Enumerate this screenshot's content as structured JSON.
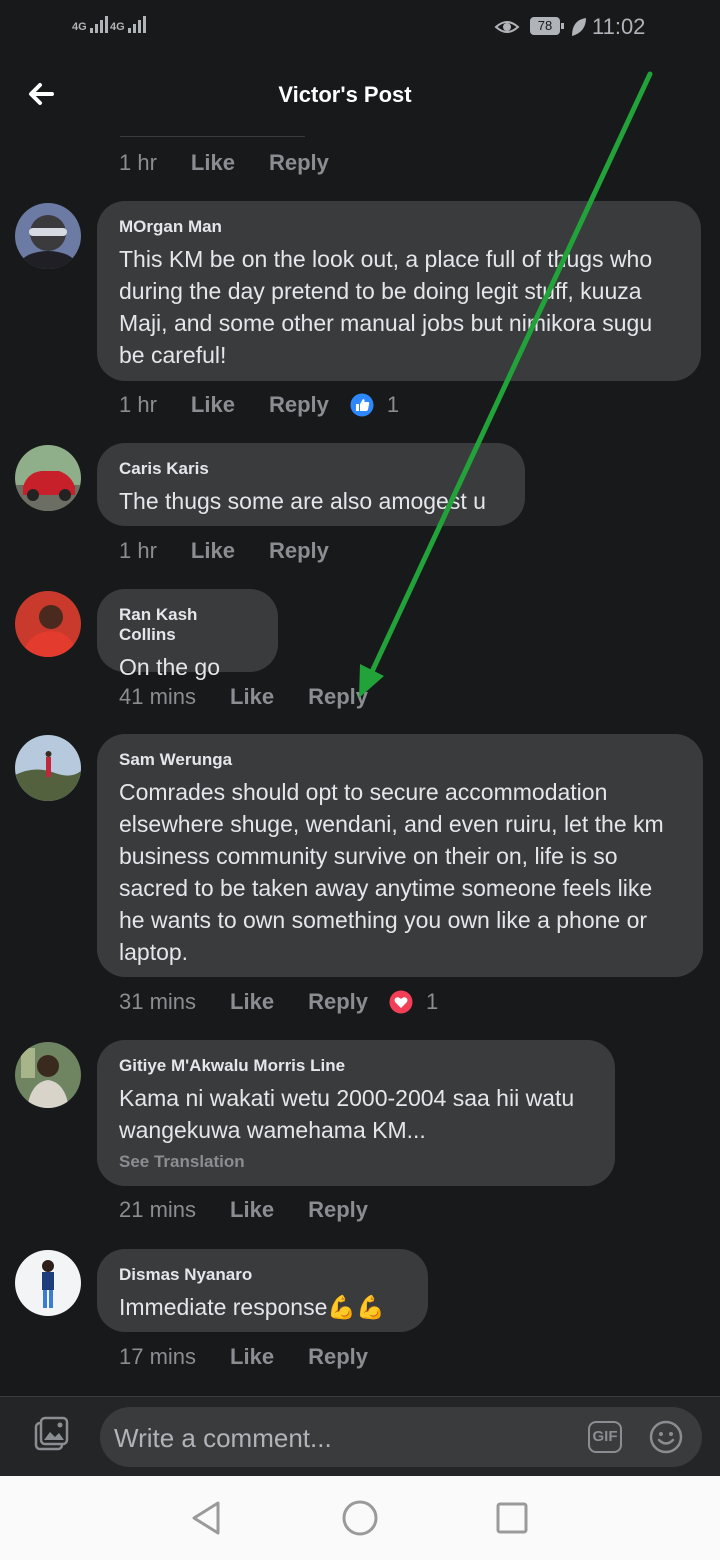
{
  "status_bar": {
    "signal_1": "4G",
    "signal_2": "4G",
    "battery": "78",
    "time": "11:02"
  },
  "header": {
    "title": "Victor's Post"
  },
  "prev_comment_meta": {
    "time": "1 hr",
    "like": "Like",
    "reply": "Reply"
  },
  "comments": [
    {
      "author": "MOrgan Man",
      "text": "This KM be on the look out, a place full of thugs who during the day pretend to be doing legit stuff, kuuza Maji, and some other manual jobs but nimikora sugu be careful!",
      "time": "1 hr",
      "like": "Like",
      "reply": "Reply",
      "reaction": "like-icon",
      "reaction_count": "1"
    },
    {
      "author": "Caris Karis",
      "text": "The thugs some are also amogest u",
      "time": "1 hr",
      "like": "Like",
      "reply": "Reply"
    },
    {
      "author": "Ran Kash Collins",
      "text": "On the go",
      "time": "41 mins",
      "like": "Like",
      "reply": "Reply"
    },
    {
      "author": "Sam Werunga",
      "text": "Comrades should opt to secure accommodation elsewhere shuge, wendani, and even ruiru, let the km business community survive on their on, life is so sacred to be taken away anytime someone feels like he wants to own something you own like a phone or laptop.",
      "time": "31 mins",
      "like": "Like",
      "reply": "Reply",
      "reaction": "love-icon",
      "reaction_count": "1"
    },
    {
      "author": "Gitiye M'Akwalu Morris Line",
      "text": "Kama ni wakati wetu 2000-2004 saa hii watu wangekuwa wamehama KM...",
      "see_translation": "See Translation",
      "time": "21 mins",
      "like": "Like",
      "reply": "Reply"
    },
    {
      "author": "Dismas Nyanaro",
      "text": "Immediate response💪💪",
      "time": "17 mins",
      "like": "Like",
      "reply": "Reply"
    }
  ],
  "composer": {
    "placeholder": "Write a comment...",
    "gif_label": "GIF"
  },
  "colors": {
    "background": "#18191a",
    "bubble": "#3a3b3c",
    "annotation_arrow": "#22a33a",
    "like_blue": "#2d88ff",
    "love_red": "#f33e58"
  }
}
